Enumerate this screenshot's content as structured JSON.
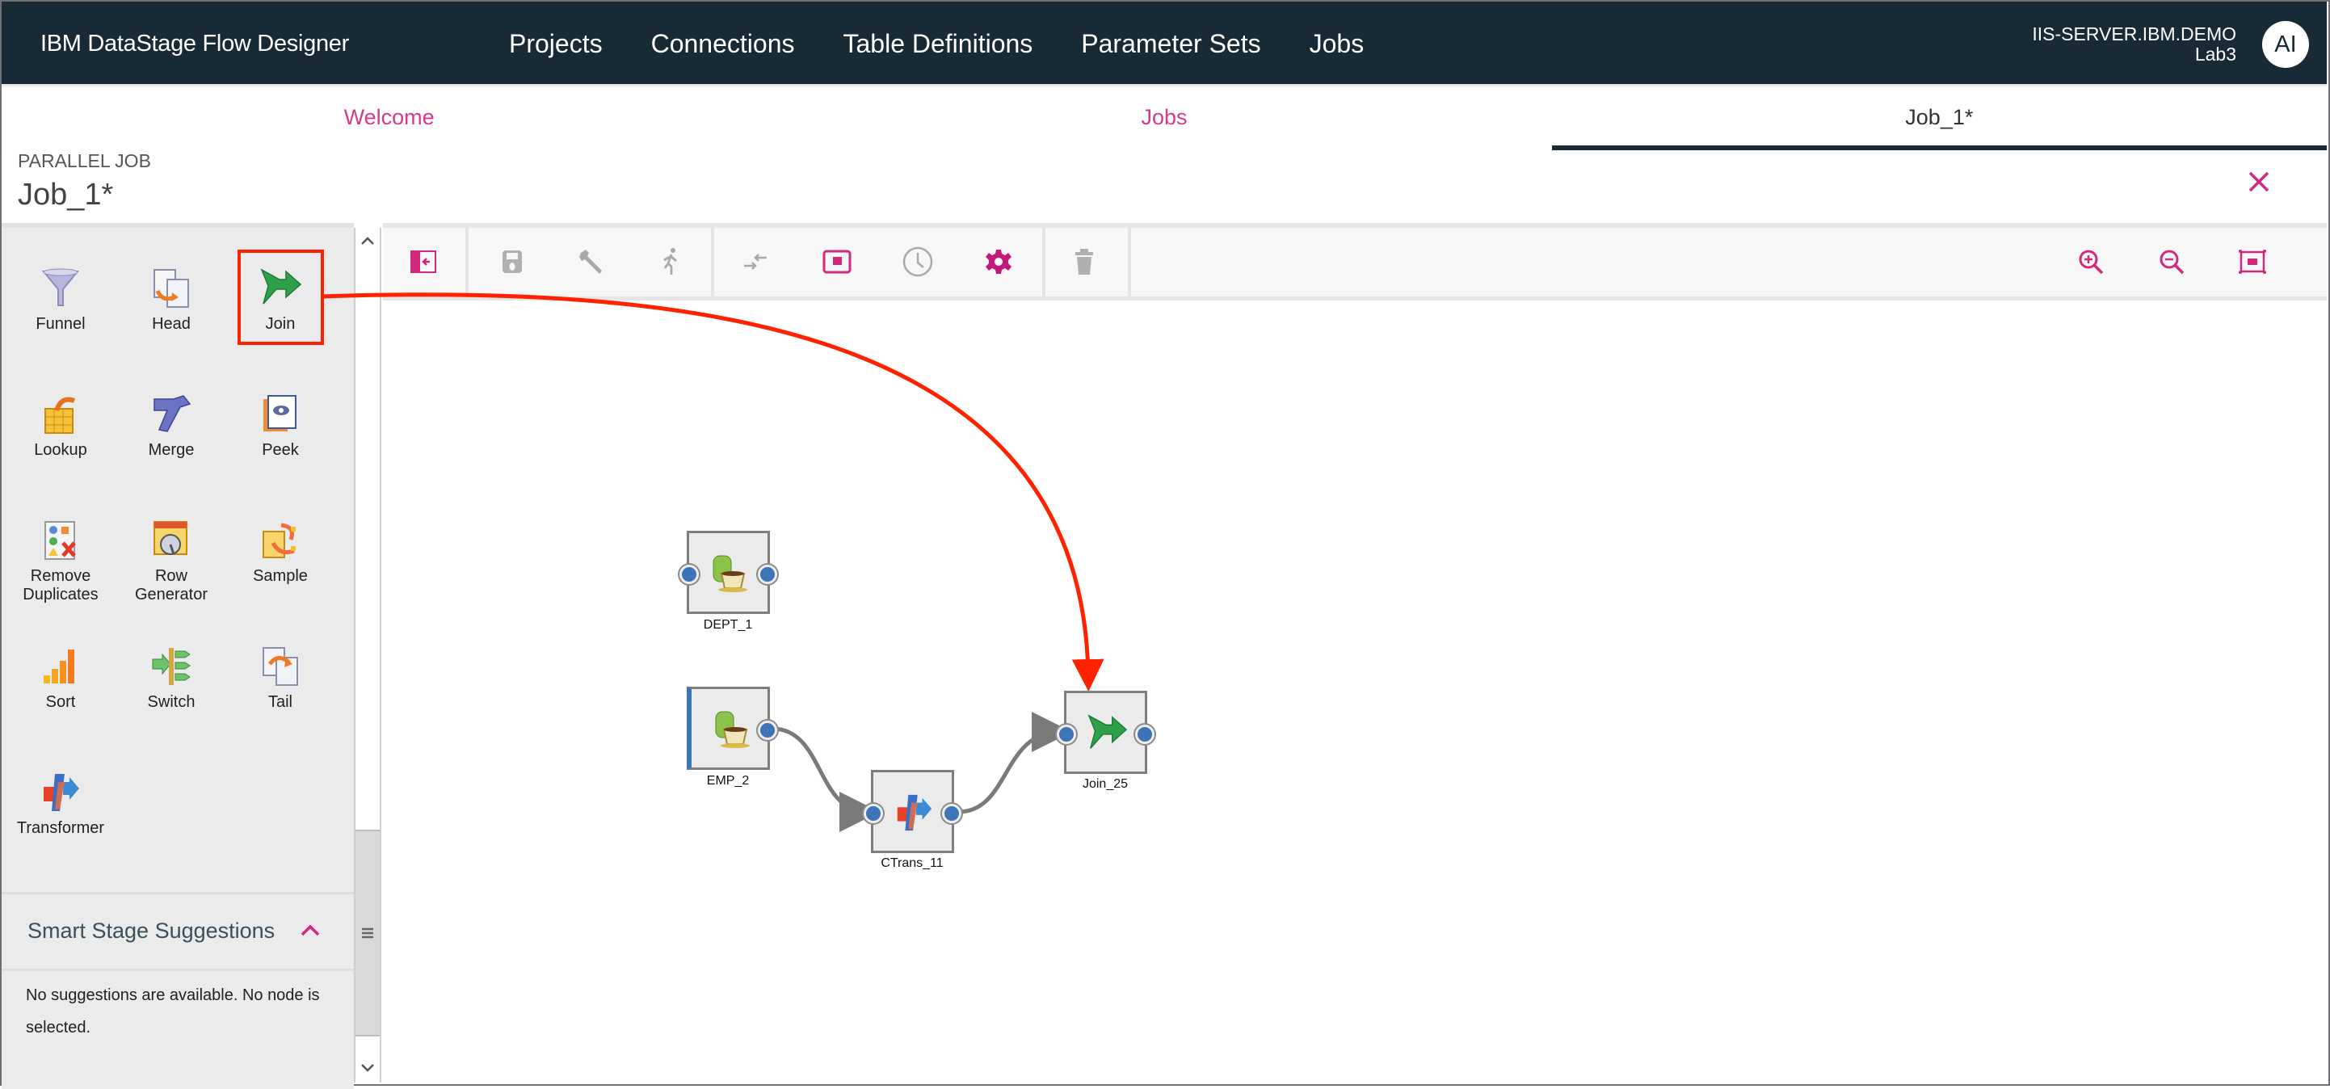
{
  "header": {
    "app_title": "IBM DataStage Flow Designer",
    "nav": [
      "Projects",
      "Connections",
      "Table Definitions",
      "Parameter Sets",
      "Jobs"
    ],
    "server": "IIS-SERVER.IBM.DEMO",
    "project": "Lab3",
    "avatar_initials": "AI"
  },
  "tabs": [
    {
      "label": "Welcome",
      "active": false
    },
    {
      "label": "Jobs",
      "active": false
    },
    {
      "label": "Job_1*",
      "active": true
    }
  ],
  "job": {
    "type": "PARALLEL JOB",
    "name": "Job_1*",
    "close_icon": "close-icon"
  },
  "palette": {
    "items": [
      {
        "label": "Funnel",
        "icon": "funnel-icon"
      },
      {
        "label": "Head",
        "icon": "head-icon"
      },
      {
        "label": "Join",
        "icon": "join-icon",
        "highlighted": true
      },
      {
        "label": "Lookup",
        "icon": "lookup-icon"
      },
      {
        "label": "Merge",
        "icon": "merge-icon"
      },
      {
        "label": "Peek",
        "icon": "peek-icon"
      },
      {
        "label": "Remove Duplicates",
        "icon": "remove-duplicates-icon"
      },
      {
        "label": "Row Generator",
        "icon": "row-generator-icon"
      },
      {
        "label": "Sample",
        "icon": "sample-icon"
      },
      {
        "label": "Sort",
        "icon": "sort-icon"
      },
      {
        "label": "Switch",
        "icon": "switch-icon"
      },
      {
        "label": "Tail",
        "icon": "tail-icon"
      },
      {
        "label": "Transformer",
        "icon": "transformer-icon"
      }
    ],
    "smart_suggestions": {
      "title": "Smart Stage Suggestions",
      "message": "No suggestions are available. No node is selected."
    }
  },
  "toolbar": {
    "left": [
      "toggle-palette-icon",
      "save-icon",
      "wrench-icon",
      "run-icon",
      "compile-icon",
      "preview-icon",
      "schedule-icon",
      "settings-icon",
      "delete-icon"
    ],
    "right": [
      "zoom-in-icon",
      "zoom-out-icon",
      "fit-to-screen-icon"
    ]
  },
  "canvas": {
    "nodes": [
      {
        "id": "DEPT_1",
        "label": "DEPT_1",
        "type": "source"
      },
      {
        "id": "EMP_2",
        "label": "EMP_2",
        "type": "source"
      },
      {
        "id": "CTrans_11",
        "label": "CTrans_11",
        "type": "transformer"
      },
      {
        "id": "Join_25",
        "label": "Join_25",
        "type": "join"
      }
    ],
    "links": [
      {
        "from": "EMP_2",
        "to": "CTrans_11"
      },
      {
        "from": "CTrans_11",
        "to": "Join_25"
      }
    ]
  },
  "annotation": {
    "description": "Red arrow from Join palette item to Join_25 node on canvas",
    "color": "#ff2200"
  },
  "colors": {
    "header_bg": "#172a35",
    "accent": "#d12a7d",
    "port": "#3d74b8"
  }
}
